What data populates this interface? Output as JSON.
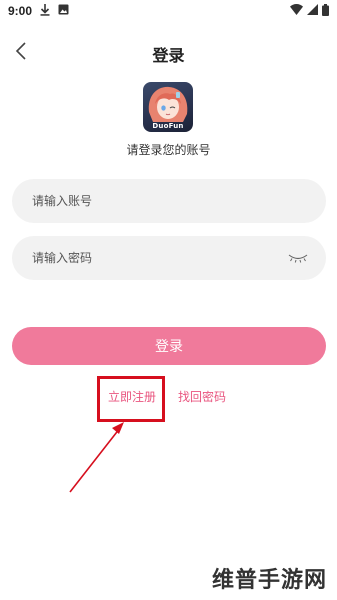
{
  "status_bar": {
    "time": "9:00",
    "icons": [
      "download-icon",
      "image-icon",
      "wifi-icon",
      "signal-icon",
      "battery-icon"
    ]
  },
  "header": {
    "title": "登录",
    "back_icon": "chevron-left-icon"
  },
  "app": {
    "logo_text": "DuoFun",
    "subtitle": "请登录您的账号"
  },
  "form": {
    "account_placeholder": "请输入账号",
    "password_placeholder": "请输入密码",
    "password_toggle_icon": "eye-closed-icon"
  },
  "buttons": {
    "login_label": "登录"
  },
  "links": {
    "register": "立即注册",
    "recover": "找回密码"
  },
  "annotation": {
    "highlight_color": "#d60f1e"
  },
  "watermark": "维普手游网",
  "colors": {
    "accent": "#f07a9b",
    "link": "#e9557f",
    "input_bg": "#f2f2f2"
  }
}
